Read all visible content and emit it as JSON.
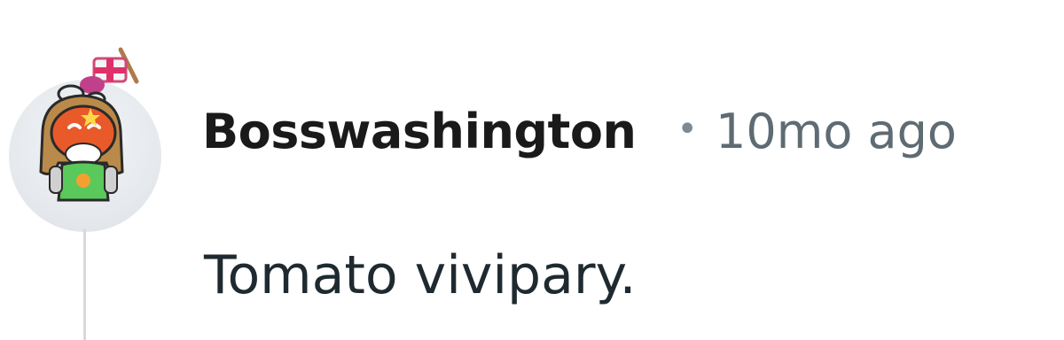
{
  "comment": {
    "avatar_icon": "snoo-avatar-icon",
    "username": "Bosswashington",
    "separator": "•",
    "timestamp": "10mo ago",
    "body": "Tomato vivipary."
  },
  "colors": {
    "username": "#1a1a1b",
    "meta": "#5f6b73",
    "thread_line": "#d7dadc"
  }
}
